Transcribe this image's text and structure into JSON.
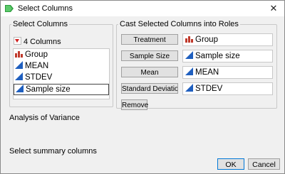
{
  "window": {
    "title": "Select Columns",
    "close_glyph": "✕"
  },
  "select_columns": {
    "legend": "Select Columns",
    "count_label": "4 Columns",
    "items": [
      {
        "label": "Group",
        "icon": "nominal-bars-icon",
        "selected": false
      },
      {
        "label": "MEAN",
        "icon": "continuous-triangle-icon",
        "selected": false
      },
      {
        "label": "STDEV",
        "icon": "continuous-triangle-icon",
        "selected": false
      },
      {
        "label": "Sample size",
        "icon": "continuous-triangle-icon",
        "selected": true
      }
    ]
  },
  "cast": {
    "legend": "Cast Selected Columns into Roles",
    "roles": [
      {
        "button": "Treatment",
        "value": "Group",
        "icon": "nominal-bars-icon"
      },
      {
        "button": "Sample Size",
        "value": "Sample size",
        "icon": "continuous-triangle-icon"
      },
      {
        "button": "Mean",
        "value": "MEAN",
        "icon": "continuous-triangle-icon"
      },
      {
        "button": "Standard Deviation",
        "value": "STDEV",
        "icon": "continuous-triangle-icon"
      }
    ],
    "remove_label": "Remove"
  },
  "analysis_label": "Analysis of Variance",
  "summary_label": "Select summary columns",
  "buttons": {
    "ok": "OK",
    "cancel": "Cancel"
  },
  "colors": {
    "nominal": "#c0392b",
    "continuous": "#1f5fbf",
    "accent": "#0078d7"
  }
}
